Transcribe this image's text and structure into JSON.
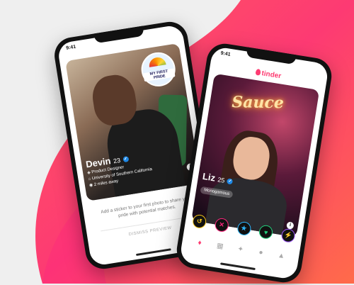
{
  "colors": {
    "brand": "#fe3c72",
    "bg_gradient_start": "#ff7854",
    "bg_gradient_end": "#fd267d"
  },
  "phone_left": {
    "status_time": "9:41",
    "sticker_text": "MY FIRST PRIDE",
    "profile": {
      "name": "Devin",
      "age": "23",
      "job": "Product Designer",
      "school": "University of Southern California",
      "distance": "2 miles away"
    },
    "caption": "Add a sticker to your first photo to share your pride with potential matches.",
    "dismiss_label": "DISMISS PREVIEW"
  },
  "phone_right": {
    "status_time": "9:41",
    "brand_name": "tinder",
    "sign_text": "Sauce",
    "profile": {
      "name": "Liz",
      "age": "25",
      "tag": "Monogamous"
    },
    "actions": [
      {
        "icon": "rewind-icon",
        "glyph": "↺",
        "color": "#f5c518"
      },
      {
        "icon": "nope-icon",
        "glyph": "✕",
        "color": "#fd267d"
      },
      {
        "icon": "super-like-icon",
        "glyph": "★",
        "color": "#2db6ff"
      },
      {
        "icon": "like-icon",
        "glyph": "♥",
        "color": "#21d07c"
      },
      {
        "icon": "boost-icon",
        "glyph": "⚡",
        "color": "#a25bff"
      }
    ],
    "tabs": [
      {
        "icon": "flame-tab-icon",
        "glyph": "♦"
      },
      {
        "icon": "explore-tab-icon",
        "glyph": "▦"
      },
      {
        "icon": "sparkle-tab-icon",
        "glyph": "✦"
      },
      {
        "icon": "chat-tab-icon",
        "glyph": "●"
      },
      {
        "icon": "profile-tab-icon",
        "glyph": "▲"
      }
    ]
  }
}
